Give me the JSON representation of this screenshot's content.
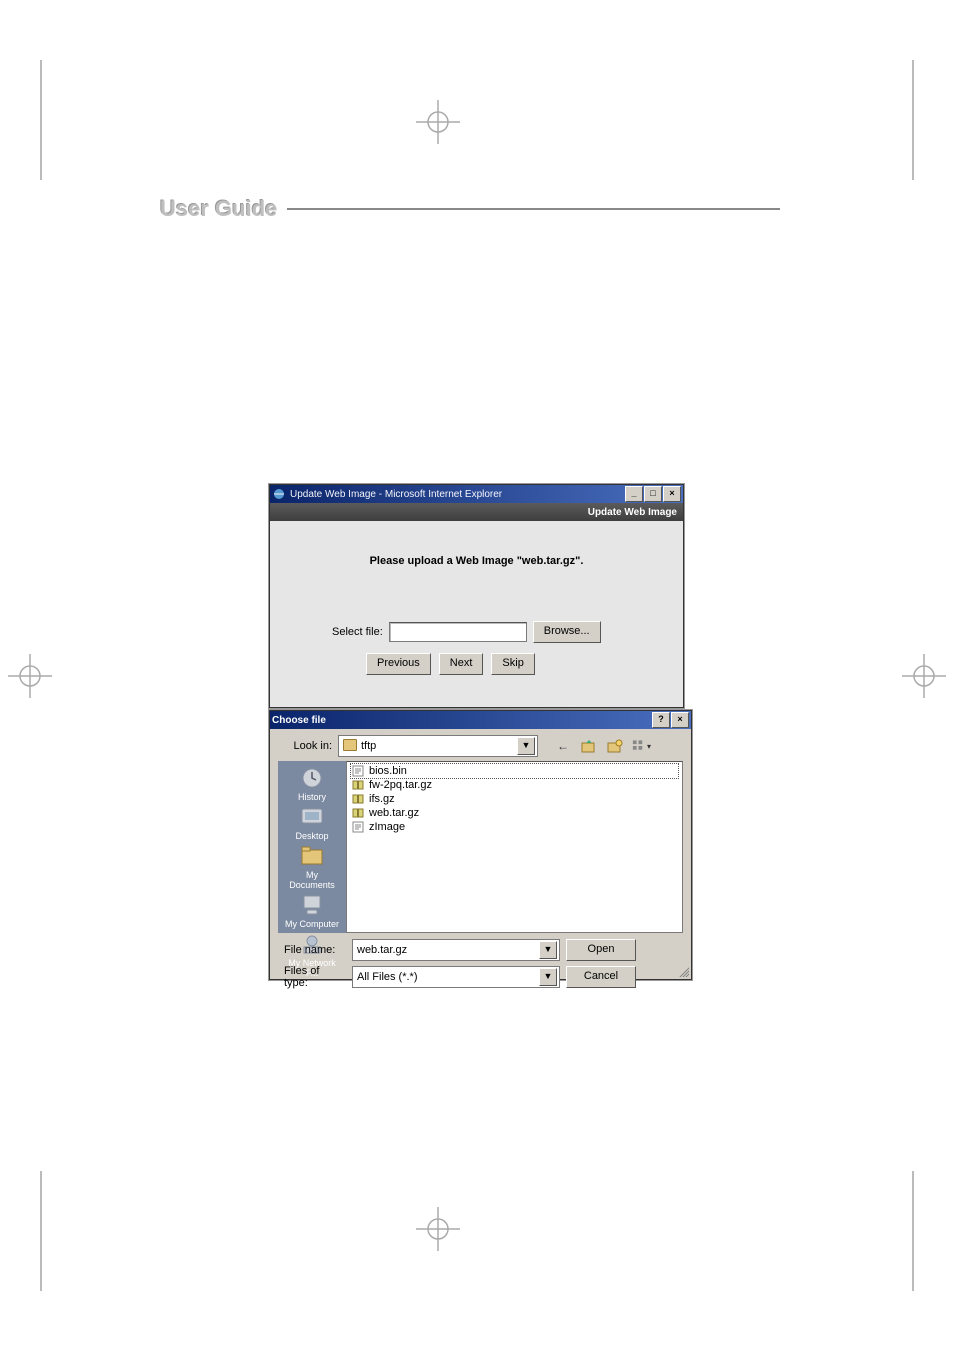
{
  "page_header": "User Guide",
  "ie_window": {
    "title": "Update Web Image - Microsoft Internet Explorer",
    "section_title": "Update Web Image",
    "instruction": "Please upload a Web Image \"web.tar.gz\".",
    "select_file_label": "Select file:",
    "select_file_value": "",
    "browse_button": "Browse...",
    "buttons": {
      "previous": "Previous",
      "next": "Next",
      "skip": "Skip"
    },
    "winbtns": {
      "min": "_",
      "max": "□",
      "close": "×"
    }
  },
  "choose_dialog": {
    "title": "Choose file",
    "help_btn": "?",
    "close_btn": "×",
    "look_in_label": "Look in:",
    "look_in_value": "tftp",
    "toolbar": {
      "back": "←",
      "up": "folder-up",
      "new_folder": "new-folder",
      "views": "views"
    },
    "places": [
      {
        "name": "History"
      },
      {
        "name": "Desktop"
      },
      {
        "name": "My Documents"
      },
      {
        "name": "My Computer"
      },
      {
        "name": "My Network P..."
      }
    ],
    "files": [
      {
        "name": "bios.bin",
        "type": "bin"
      },
      {
        "name": "fw-2pq.tar.gz",
        "type": "archive"
      },
      {
        "name": "ifs.gz",
        "type": "archive"
      },
      {
        "name": "web.tar.gz",
        "type": "archive"
      },
      {
        "name": "zImage",
        "type": "bin"
      }
    ],
    "file_name_label": "File name:",
    "file_name_value": "web.tar.gz",
    "files_of_type_label": "Files of type:",
    "files_of_type_value": "All Files (*.*)",
    "open_button": "Open",
    "cancel_button": "Cancel"
  }
}
